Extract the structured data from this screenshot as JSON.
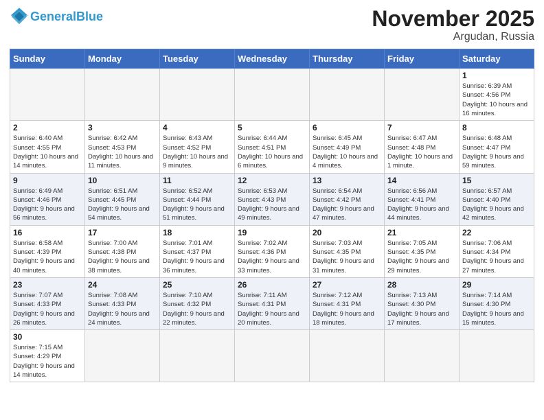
{
  "header": {
    "logo_general": "General",
    "logo_blue": "Blue",
    "month_title": "November 2025",
    "location": "Argudan, Russia"
  },
  "days_of_week": [
    "Sunday",
    "Monday",
    "Tuesday",
    "Wednesday",
    "Thursday",
    "Friday",
    "Saturday"
  ],
  "weeks": [
    [
      {
        "day": "",
        "info": ""
      },
      {
        "day": "",
        "info": ""
      },
      {
        "day": "",
        "info": ""
      },
      {
        "day": "",
        "info": ""
      },
      {
        "day": "",
        "info": ""
      },
      {
        "day": "",
        "info": ""
      },
      {
        "day": "1",
        "info": "Sunrise: 6:39 AM\nSunset: 4:56 PM\nDaylight: 10 hours and 16 minutes."
      }
    ],
    [
      {
        "day": "2",
        "info": "Sunrise: 6:40 AM\nSunset: 4:55 PM\nDaylight: 10 hours and 14 minutes."
      },
      {
        "day": "3",
        "info": "Sunrise: 6:42 AM\nSunset: 4:53 PM\nDaylight: 10 hours and 11 minutes."
      },
      {
        "day": "4",
        "info": "Sunrise: 6:43 AM\nSunset: 4:52 PM\nDaylight: 10 hours and 9 minutes."
      },
      {
        "day": "5",
        "info": "Sunrise: 6:44 AM\nSunset: 4:51 PM\nDaylight: 10 hours and 6 minutes."
      },
      {
        "day": "6",
        "info": "Sunrise: 6:45 AM\nSunset: 4:49 PM\nDaylight: 10 hours and 4 minutes."
      },
      {
        "day": "7",
        "info": "Sunrise: 6:47 AM\nSunset: 4:48 PM\nDaylight: 10 hours and 1 minute."
      },
      {
        "day": "8",
        "info": "Sunrise: 6:48 AM\nSunset: 4:47 PM\nDaylight: 9 hours and 59 minutes."
      }
    ],
    [
      {
        "day": "9",
        "info": "Sunrise: 6:49 AM\nSunset: 4:46 PM\nDaylight: 9 hours and 56 minutes."
      },
      {
        "day": "10",
        "info": "Sunrise: 6:51 AM\nSunset: 4:45 PM\nDaylight: 9 hours and 54 minutes."
      },
      {
        "day": "11",
        "info": "Sunrise: 6:52 AM\nSunset: 4:44 PM\nDaylight: 9 hours and 51 minutes."
      },
      {
        "day": "12",
        "info": "Sunrise: 6:53 AM\nSunset: 4:43 PM\nDaylight: 9 hours and 49 minutes."
      },
      {
        "day": "13",
        "info": "Sunrise: 6:54 AM\nSunset: 4:42 PM\nDaylight: 9 hours and 47 minutes."
      },
      {
        "day": "14",
        "info": "Sunrise: 6:56 AM\nSunset: 4:41 PM\nDaylight: 9 hours and 44 minutes."
      },
      {
        "day": "15",
        "info": "Sunrise: 6:57 AM\nSunset: 4:40 PM\nDaylight: 9 hours and 42 minutes."
      }
    ],
    [
      {
        "day": "16",
        "info": "Sunrise: 6:58 AM\nSunset: 4:39 PM\nDaylight: 9 hours and 40 minutes."
      },
      {
        "day": "17",
        "info": "Sunrise: 7:00 AM\nSunset: 4:38 PM\nDaylight: 9 hours and 38 minutes."
      },
      {
        "day": "18",
        "info": "Sunrise: 7:01 AM\nSunset: 4:37 PM\nDaylight: 9 hours and 36 minutes."
      },
      {
        "day": "19",
        "info": "Sunrise: 7:02 AM\nSunset: 4:36 PM\nDaylight: 9 hours and 33 minutes."
      },
      {
        "day": "20",
        "info": "Sunrise: 7:03 AM\nSunset: 4:35 PM\nDaylight: 9 hours and 31 minutes."
      },
      {
        "day": "21",
        "info": "Sunrise: 7:05 AM\nSunset: 4:35 PM\nDaylight: 9 hours and 29 minutes."
      },
      {
        "day": "22",
        "info": "Sunrise: 7:06 AM\nSunset: 4:34 PM\nDaylight: 9 hours and 27 minutes."
      }
    ],
    [
      {
        "day": "23",
        "info": "Sunrise: 7:07 AM\nSunset: 4:33 PM\nDaylight: 9 hours and 26 minutes."
      },
      {
        "day": "24",
        "info": "Sunrise: 7:08 AM\nSunset: 4:33 PM\nDaylight: 9 hours and 24 minutes."
      },
      {
        "day": "25",
        "info": "Sunrise: 7:10 AM\nSunset: 4:32 PM\nDaylight: 9 hours and 22 minutes."
      },
      {
        "day": "26",
        "info": "Sunrise: 7:11 AM\nSunset: 4:31 PM\nDaylight: 9 hours and 20 minutes."
      },
      {
        "day": "27",
        "info": "Sunrise: 7:12 AM\nSunset: 4:31 PM\nDaylight: 9 hours and 18 minutes."
      },
      {
        "day": "28",
        "info": "Sunrise: 7:13 AM\nSunset: 4:30 PM\nDaylight: 9 hours and 17 minutes."
      },
      {
        "day": "29",
        "info": "Sunrise: 7:14 AM\nSunset: 4:30 PM\nDaylight: 9 hours and 15 minutes."
      }
    ],
    [
      {
        "day": "30",
        "info": "Sunrise: 7:15 AM\nSunset: 4:29 PM\nDaylight: 9 hours and 14 minutes."
      },
      {
        "day": "",
        "info": ""
      },
      {
        "day": "",
        "info": ""
      },
      {
        "day": "",
        "info": ""
      },
      {
        "day": "",
        "info": ""
      },
      {
        "day": "",
        "info": ""
      },
      {
        "day": "",
        "info": ""
      }
    ]
  ]
}
